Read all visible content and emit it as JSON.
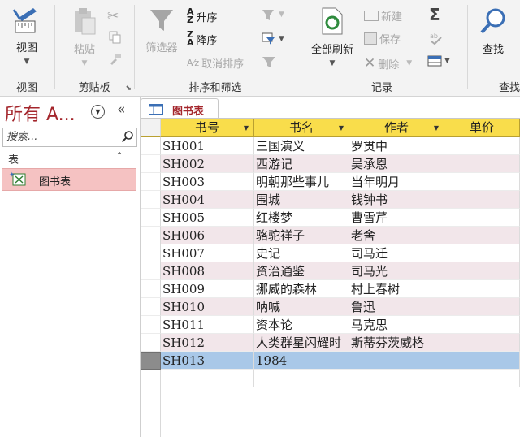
{
  "ribbon": {
    "view_group": {
      "label": "视图",
      "view_btn": "视图"
    },
    "clipboard_group": {
      "label": "剪贴板",
      "paste": "粘贴"
    },
    "sort_filter_group": {
      "label": "排序和筛选",
      "filter": "筛选器",
      "ascending": "升序",
      "descending": "降序",
      "remove_sort": "取消排序"
    },
    "records_group": {
      "label": "记录",
      "refresh_all": "全部刷新",
      "new": "新建",
      "save": "保存",
      "delete": "删除",
      "sum_symbol": "Σ"
    },
    "find_group": {
      "label": "查找",
      "find": "查找"
    }
  },
  "nav": {
    "title": "所有 A...",
    "search_placeholder": "搜索...",
    "section": "表",
    "items": [
      {
        "label": "图书表"
      }
    ]
  },
  "document": {
    "tab": "图书表",
    "columns": [
      "书号",
      "书名",
      "作者",
      "单价"
    ],
    "rows": [
      [
        "SH001",
        "三国演义",
        "罗贯中",
        ""
      ],
      [
        "SH002",
        "西游记",
        "吴承恩",
        ""
      ],
      [
        "SH003",
        "明朝那些事儿",
        "当年明月",
        ""
      ],
      [
        "SH004",
        "围城",
        "钱钟书",
        ""
      ],
      [
        "SH005",
        "红楼梦",
        "曹雪芹",
        ""
      ],
      [
        "SH006",
        "骆驼祥子",
        "老舍",
        ""
      ],
      [
        "SH007",
        "史记",
        "司马迁",
        ""
      ],
      [
        "SH008",
        "资治通鉴",
        "司马光",
        ""
      ],
      [
        "SH009",
        "挪威的森林",
        "村上春树",
        ""
      ],
      [
        "SH010",
        "呐喊",
        "鲁迅",
        ""
      ],
      [
        "SH011",
        "资本论",
        "马克思",
        ""
      ],
      [
        "SH012",
        "人类群星闪耀时",
        "斯蒂芬茨威格",
        ""
      ],
      [
        "SH013",
        "1984",
        "",
        ""
      ]
    ],
    "selected_row": 12
  },
  "colors": {
    "accent": "#a4262c",
    "header_bg": "#f9dd4b",
    "alt_row": "#f2e6ea",
    "selected_row": "#a9c8e8",
    "nav_selected": "#f5c2c2"
  }
}
